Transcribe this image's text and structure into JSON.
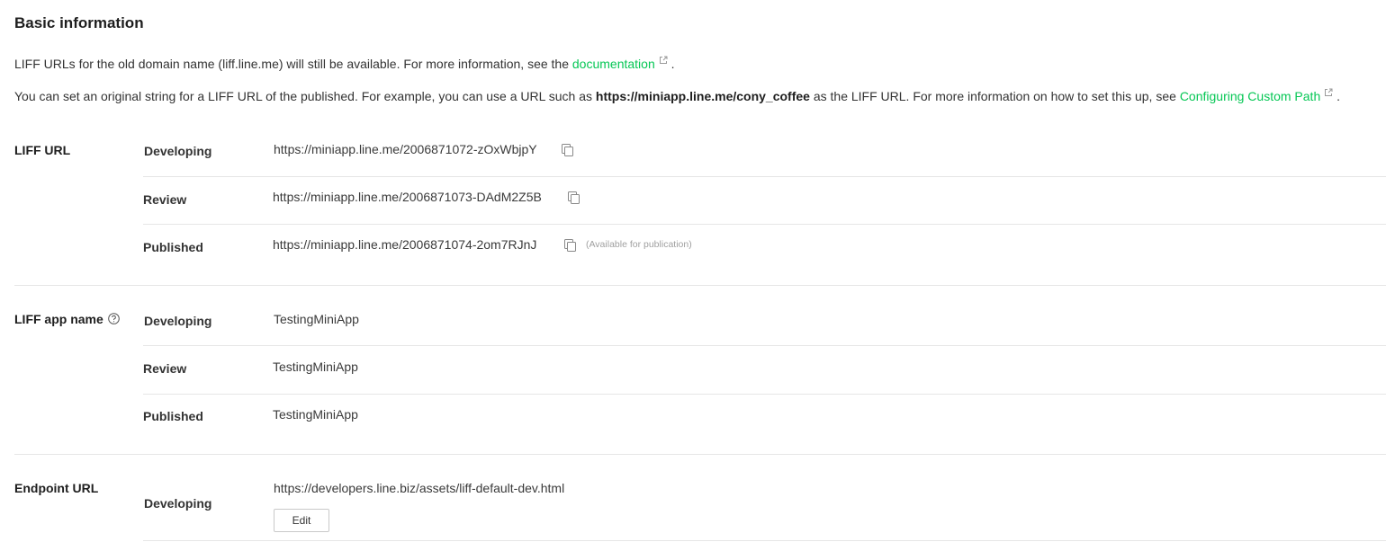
{
  "title": "Basic information",
  "notice1": {
    "text": "LIFF URLs for the old domain name (liff.line.me) will still be available. For more information, see the ",
    "link": "documentation",
    "end": "."
  },
  "notice2": {
    "text_a": "You can set an original string for a LIFF URL of the published. For example, you can use a URL such as ",
    "bold": "https://miniapp.line.me/cony_coffee",
    "text_b": " as the LIFF URL. For more information on how to set this up, see ",
    "link": "Configuring Custom Path",
    "end": "."
  },
  "liff_url": {
    "label": "LIFF URL",
    "rows": [
      {
        "stage": "Developing",
        "value": "https://miniapp.line.me/2006871072-zOxWbjpY"
      },
      {
        "stage": "Review",
        "value": "https://miniapp.line.me/2006871073-DAdM2Z5B"
      },
      {
        "stage": "Published",
        "value": "https://miniapp.line.me/2006871074-2om7RJnJ",
        "note": "(Available for publication)"
      }
    ]
  },
  "liff_app_name": {
    "label": "LIFF app name",
    "rows": [
      {
        "stage": "Developing",
        "value": "TestingMiniApp"
      },
      {
        "stage": "Review",
        "value": "TestingMiniApp"
      },
      {
        "stage": "Published",
        "value": "TestingMiniApp"
      }
    ]
  },
  "endpoint_url": {
    "label": "Endpoint URL",
    "rows": [
      {
        "stage": "Developing",
        "value": "https://developers.line.biz/assets/liff-default-dev.html",
        "button": "Edit"
      }
    ]
  },
  "colors": {
    "link": "#06c755",
    "separator": "#e6e6e6"
  },
  "icons": [
    "external-link-icon",
    "copy-icon",
    "help-icon"
  ]
}
